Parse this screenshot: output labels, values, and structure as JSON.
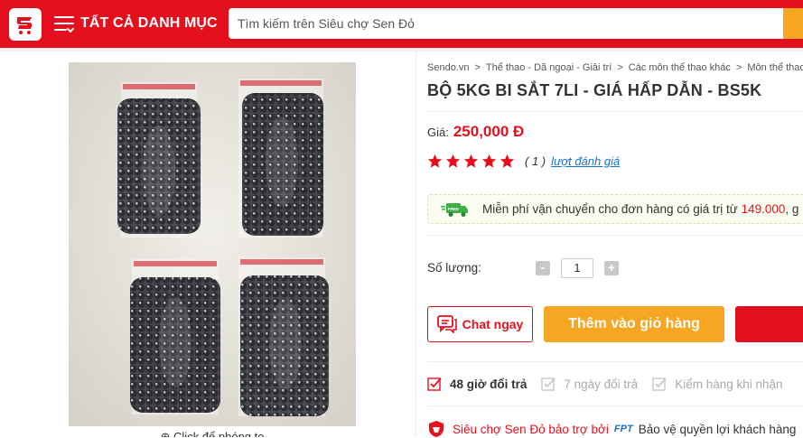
{
  "header": {
    "menu_label": "TẤT CẢ DANH MỤC",
    "search_placeholder": "Tìm kiếm trên Siêu chợ Sen Đỏ",
    "brand_color": "#e5101d",
    "accent_color": "#f6a623"
  },
  "gallery": {
    "zoom_hint": "Click để phóng to"
  },
  "breadcrumb": [
    "Sendo.vn",
    "Thể thao - Dã ngoại - Giải trí",
    "Các môn thể thao khác",
    "Môn thể thao k"
  ],
  "product": {
    "title": "BỘ 5KG BI SẮT 7LI - GIÁ HẤP DẪN - BS5K",
    "price_label": "Giá:",
    "price": "250,000 Đ",
    "stars": 5,
    "rating_count": "( 1 )",
    "rating_link": "lượt đánh giá"
  },
  "shipping": {
    "text": "Miễn phí vận chuyển cho đơn hàng có giá trị từ ",
    "amount": "149.000",
    "suffix": ", g"
  },
  "quantity": {
    "label": "Số lượng:",
    "minus": "-",
    "value": "1",
    "plus": "+"
  },
  "actions": {
    "chat": "Chat ngay",
    "add_to_cart": "Thêm vào giỏ hàng"
  },
  "policies": [
    {
      "label": "48 giờ đổi trả",
      "active": true
    },
    {
      "label": "7 ngày đổi trả",
      "active": false
    },
    {
      "label": "Kiểm hàng khi nhận",
      "active": false
    }
  ],
  "protection": {
    "text": "Siêu chợ Sen Đỏ bảo trợ bởi",
    "partner": "FPT",
    "suffix": "Bảo vệ quyền lợi khách hàng"
  }
}
